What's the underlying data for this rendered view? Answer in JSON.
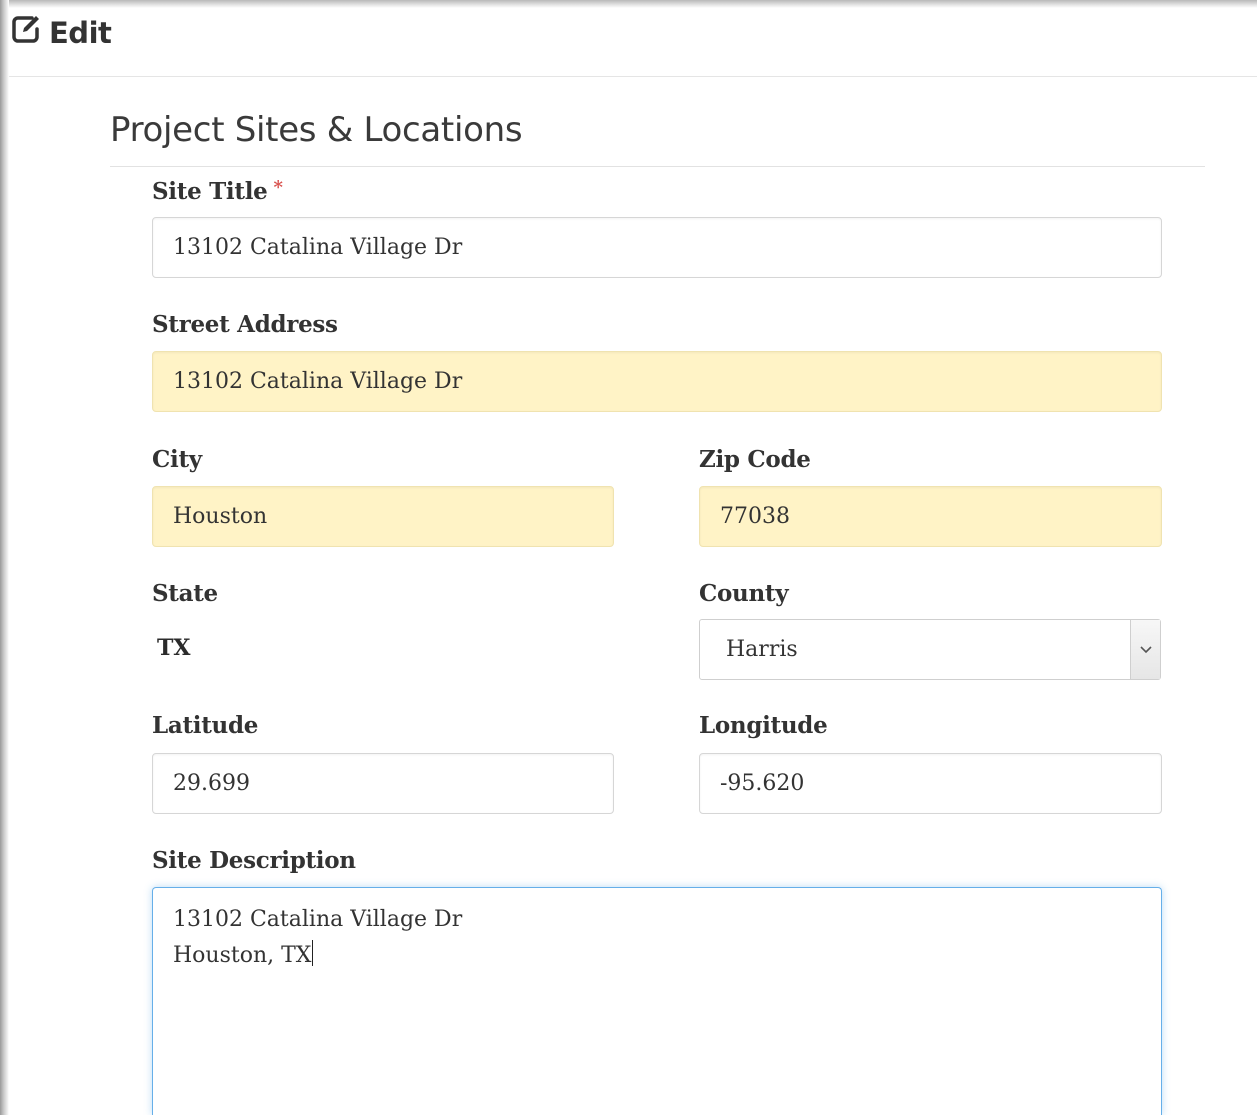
{
  "header": {
    "title": "Edit",
    "icon": "edit-icon"
  },
  "section": {
    "title": "Project Sites & Locations"
  },
  "form": {
    "site_title": {
      "label": "Site Title",
      "required_marker": "*",
      "value": "13102 Catalina Village Dr"
    },
    "street_address": {
      "label": "Street Address",
      "value": "13102 Catalina Village Dr"
    },
    "city": {
      "label": "City",
      "value": "Houston"
    },
    "zip_code": {
      "label": "Zip Code",
      "value": "77038"
    },
    "state": {
      "label": "State",
      "value": "TX"
    },
    "county": {
      "label": "County",
      "selected": "Harris",
      "icon": "chevron-down-icon"
    },
    "latitude": {
      "label": "Latitude",
      "value": "29.699"
    },
    "longitude": {
      "label": "Longitude",
      "value": "-95.620"
    },
    "site_description": {
      "label": "Site Description",
      "lines": [
        "13102 Catalina Village Dr",
        "Houston, TX"
      ]
    }
  },
  "colors": {
    "autofill_background": "#fff3c6",
    "required_marker": "#d9534f",
    "focus_border": "#66afe9"
  }
}
